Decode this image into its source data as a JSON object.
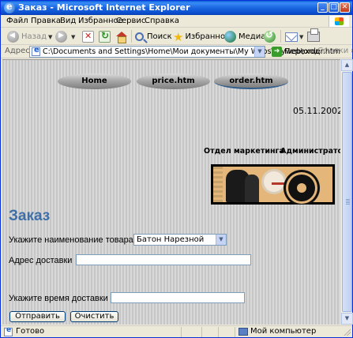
{
  "window": {
    "title": "Заказ - Microsoft Internet Explorer"
  },
  "menu": {
    "file": "Файл",
    "edit": "Правка",
    "view": "Вид",
    "favorites": "Избранное",
    "tools": "Сервис",
    "help": "Справка"
  },
  "toolbar": {
    "back": "Назад",
    "search": "Поиск",
    "favorites": "Избранное",
    "media": "Медиа"
  },
  "address": {
    "label": "Адрес:",
    "url": "C:\\Documents and Settings\\Home\\Мои документы\\My Webs\\myweb\\order.htm",
    "go": "Переход",
    "links": "Ссылки"
  },
  "page": {
    "nav": {
      "home": "Home",
      "price": "price.htm",
      "order": "order.htm"
    },
    "date": "05.11.2002",
    "top_links": {
      "marketing": "Отдел маркетинга",
      "admin": "Администратор"
    },
    "heading": "Заказ",
    "form": {
      "product_label": "Укажите наименование товара",
      "product_value": "Батон Нарезной",
      "address_label": "Адрес доставки",
      "address_value": "",
      "time_label": "Укажите время доставки",
      "time_value": "",
      "submit": "Отправить",
      "reset": "Очистить"
    }
  },
  "status": {
    "text": "Готово",
    "zone": "Мой компьютер"
  },
  "colors": {
    "heading": "#3e6fa8",
    "titlebar": "#0a5fd8"
  }
}
